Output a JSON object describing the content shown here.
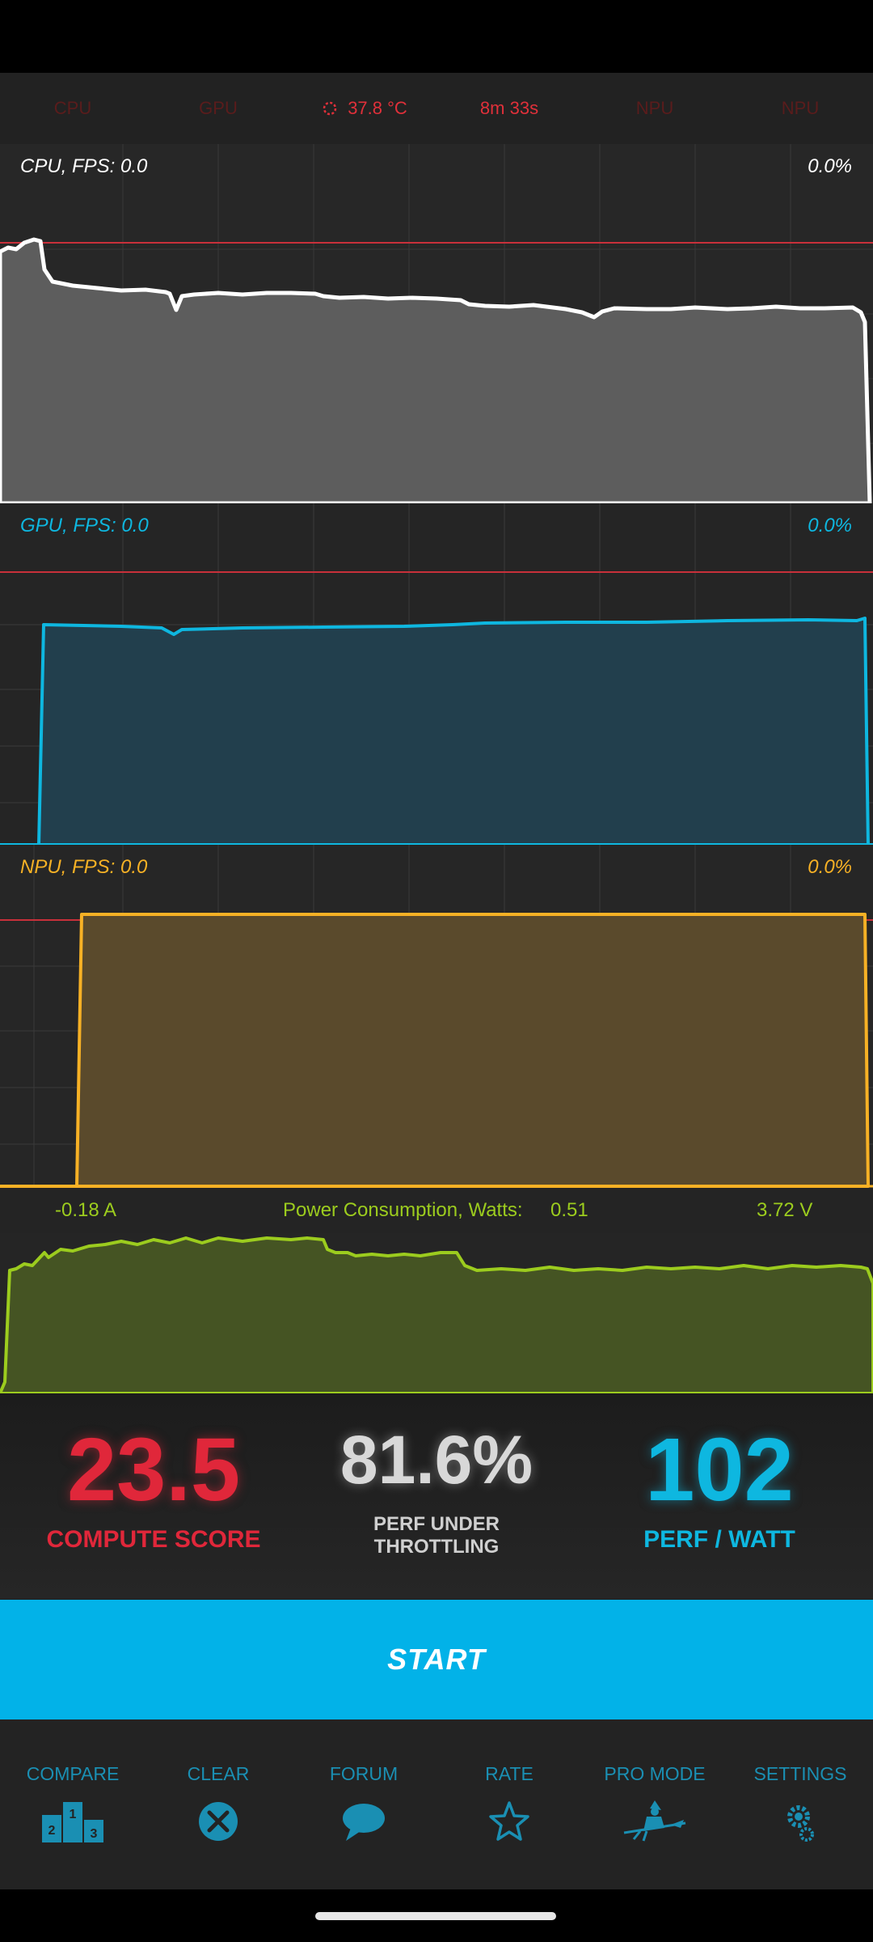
{
  "top_bar": {
    "items": [
      "CPU",
      "GPU"
    ],
    "temperature": "37.8 °C",
    "elapsed": "8m 33s",
    "items_right": [
      "NPU",
      "NPU"
    ]
  },
  "cpu": {
    "label": "CPU, FPS:  0.0",
    "percent": "0.0%"
  },
  "gpu": {
    "label": "GPU, FPS:  0.0",
    "percent": "0.0%"
  },
  "npu": {
    "label": "NPU, FPS:  0.0",
    "percent": "0.0%"
  },
  "power": {
    "current": "-0.18 A",
    "title": "Power Consumption, Watts:",
    "watts": "0.51",
    "voltage": "3.72 V"
  },
  "scores": {
    "compute_value": "23.5",
    "compute_label": "COMPUTE SCORE",
    "throttle_value": "81.6%",
    "throttle_label_line1": "PERF UNDER",
    "throttle_label_line2": "THROTTLING",
    "perfwatt_value": "102",
    "perfwatt_label": "PERF / WATT"
  },
  "start_label": "START",
  "nav": [
    "COMPARE",
    "CLEAR",
    "FORUM",
    "RATE",
    "PRO MODE",
    "SETTINGS"
  ],
  "colors": {
    "cpu": "#ffffff",
    "gpu": "#0eb7e0",
    "npu": "#f7b125",
    "power": "#9ccc1e",
    "limit_line": "#c8303a",
    "compute": "#e0273a"
  },
  "icons": [
    "podium-icon",
    "clear-x-icon",
    "speech-bubble-icon",
    "star-icon",
    "witch-icon",
    "gear-icon"
  ]
}
